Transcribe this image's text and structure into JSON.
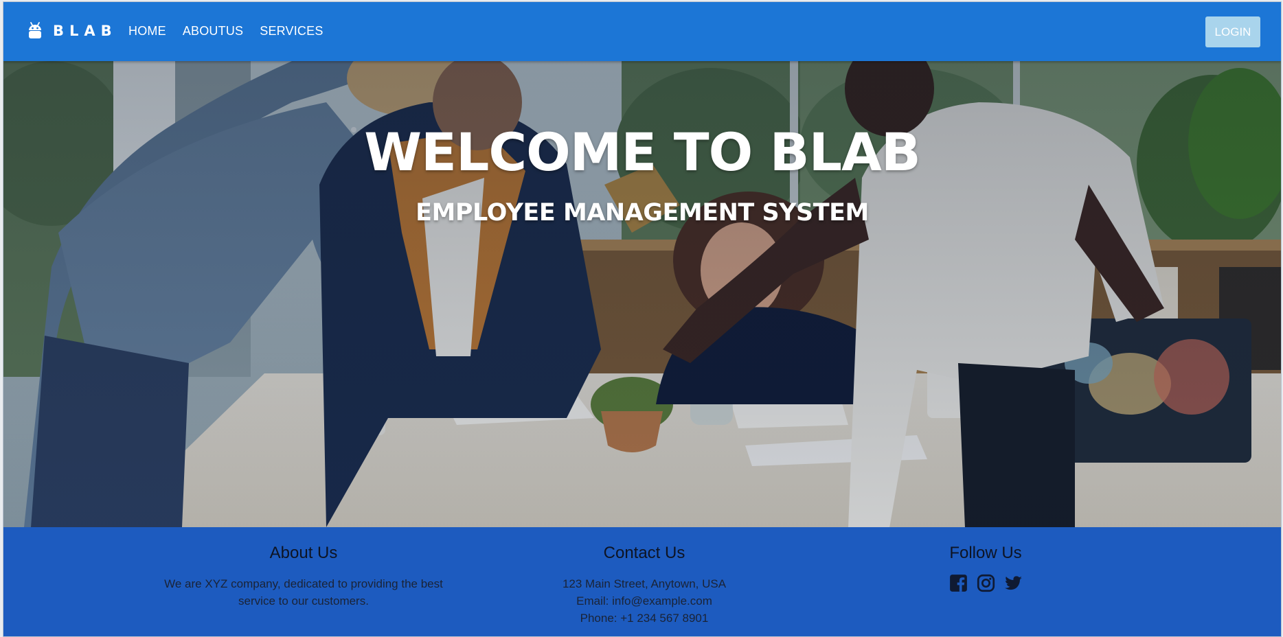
{
  "navbar": {
    "brand_text": "BLAB",
    "links": [
      "HOME",
      "ABOUTUS",
      "SERVICES"
    ],
    "login_label": "LOGIN",
    "color": "#1c76d6"
  },
  "hero": {
    "title": "WELCOME TO BLAB",
    "subtitle": "EMPLOYEE MANAGEMENT SYSTEM"
  },
  "footer": {
    "color": "#1d5bbf",
    "about": {
      "heading": "About Us",
      "text": "We are XYZ company, dedicated to providing the best service to our customers."
    },
    "contact": {
      "heading": "Contact Us",
      "address": "123 Main Street, Anytown, USA",
      "email": "Email: info@example.com",
      "phone": "Phone: +1 234 567 8901"
    },
    "follow": {
      "heading": "Follow Us",
      "icons": [
        "facebook-icon",
        "instagram-icon",
        "twitter-icon"
      ]
    }
  }
}
